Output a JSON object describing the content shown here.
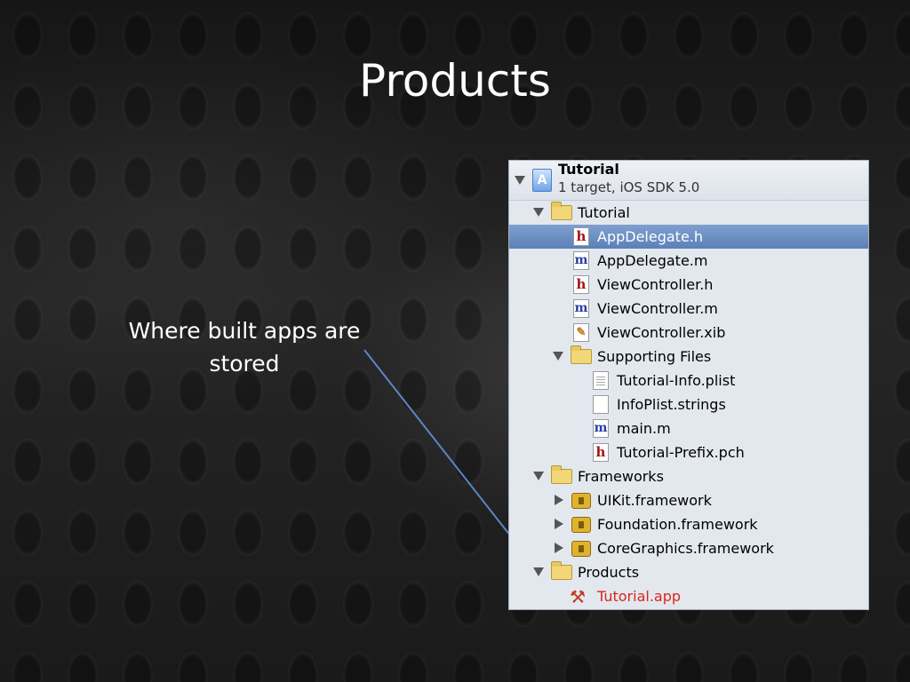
{
  "slide": {
    "title": "Products",
    "caption_line1": "Where built apps are",
    "caption_line2": "stored"
  },
  "colors": {
    "background": "#1c1c1c",
    "selection": "#6b8cc4",
    "pointer_line": "#5b86c7",
    "missing_product_text": "#d9261c"
  },
  "navigator": {
    "project": {
      "name": "Tutorial",
      "subtitle": "1 target, iOS SDK 5.0",
      "icon": "xcode-project-icon"
    },
    "items": [
      {
        "label": "Tutorial",
        "icon": "folder-icon",
        "disclosure": "expanded",
        "selected": false
      },
      {
        "label": "AppDelegate.h",
        "icon": "header-file-icon",
        "disclosure": "none",
        "selected": true
      },
      {
        "label": "AppDelegate.m",
        "icon": "implementation-file-icon",
        "disclosure": "none",
        "selected": false
      },
      {
        "label": "ViewController.h",
        "icon": "header-file-icon",
        "disclosure": "none",
        "selected": false
      },
      {
        "label": "ViewController.m",
        "icon": "implementation-file-icon",
        "disclosure": "none",
        "selected": false
      },
      {
        "label": "ViewController.xib",
        "icon": "xib-file-icon",
        "disclosure": "none",
        "selected": false
      },
      {
        "label": "Supporting Files",
        "icon": "folder-icon",
        "disclosure": "expanded",
        "selected": false
      },
      {
        "label": "Tutorial-Info.plist",
        "icon": "plist-file-icon",
        "disclosure": "none",
        "selected": false
      },
      {
        "label": "InfoPlist.strings",
        "icon": "strings-file-icon",
        "disclosure": "none",
        "selected": false
      },
      {
        "label": "main.m",
        "icon": "implementation-file-icon",
        "disclosure": "none",
        "selected": false
      },
      {
        "label": "Tutorial-Prefix.pch",
        "icon": "header-file-icon",
        "disclosure": "none",
        "selected": false
      },
      {
        "label": "Frameworks",
        "icon": "folder-icon",
        "disclosure": "expanded",
        "selected": false
      },
      {
        "label": "UIKit.framework",
        "icon": "framework-icon",
        "disclosure": "collapsed",
        "selected": false
      },
      {
        "label": "Foundation.framework",
        "icon": "framework-icon",
        "disclosure": "collapsed",
        "selected": false
      },
      {
        "label": "CoreGraphics.framework",
        "icon": "framework-icon",
        "disclosure": "collapsed",
        "selected": false
      },
      {
        "label": "Products",
        "icon": "folder-icon",
        "disclosure": "expanded",
        "selected": false
      },
      {
        "label": "Tutorial.app",
        "icon": "app-icon",
        "disclosure": "none",
        "selected": false
      }
    ]
  }
}
